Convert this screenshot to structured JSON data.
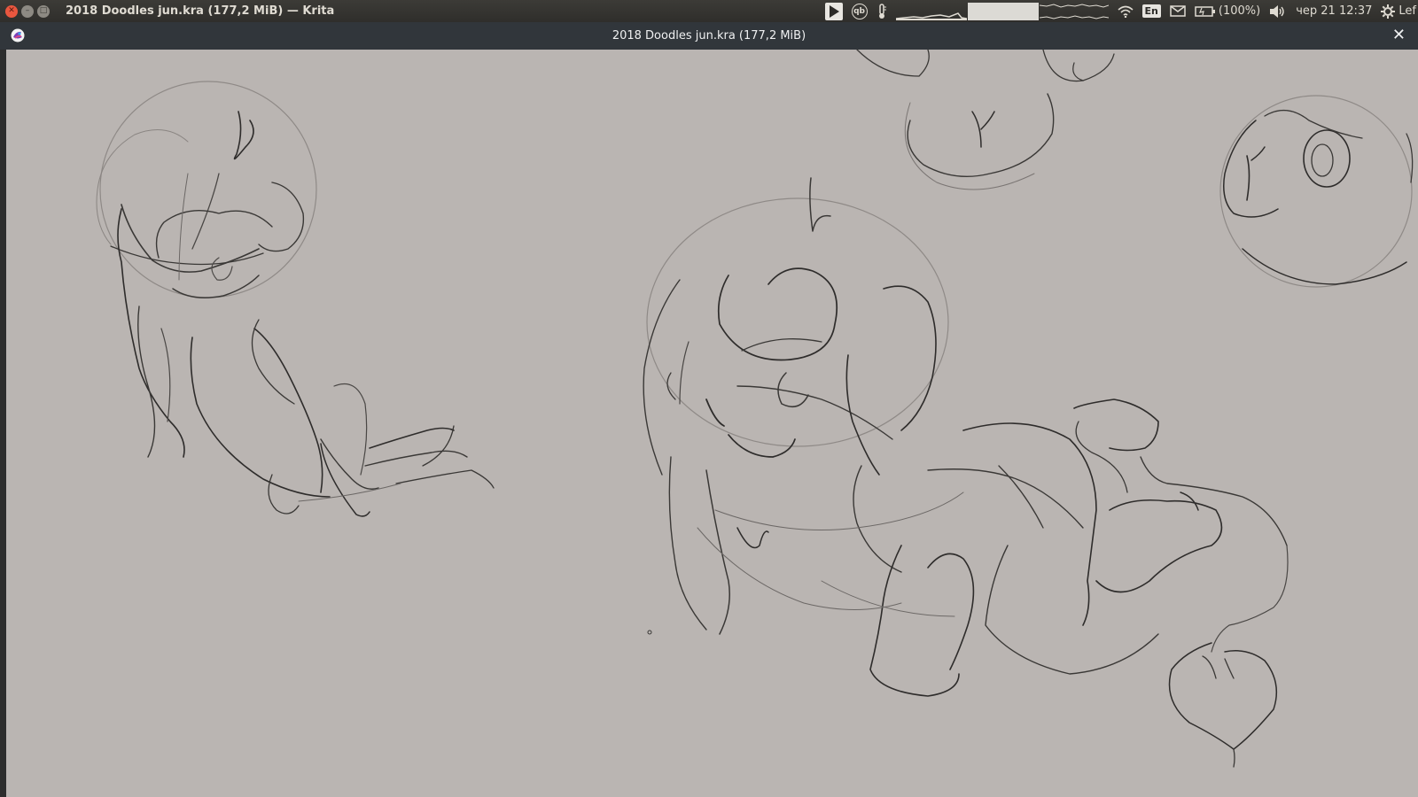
{
  "topbar": {
    "app_title": "2018 Doodles jun.kra (177,2 MiB)  — Krita",
    "language": "En",
    "battery": "(100%)",
    "datetime": "чер 21 12:37",
    "user": "Lef"
  },
  "window": {
    "title": "2018 Doodles jun.kra (177,2 MiB)",
    "close_glyph": "✕"
  },
  "colors": {
    "canvas_bg": "#bab5b2",
    "window_bar": "#31363b",
    "top_panel": "#3c3b37",
    "close_button": "#e9573f"
  },
  "icons": [
    "close-icon",
    "minimize-icon",
    "maximize-icon",
    "play-icon",
    "qbittorrent-icon",
    "temperature-icon",
    "wifi-icon",
    "mail-icon",
    "battery-icon",
    "volume-icon",
    "gear-icon",
    "krita-logo-icon"
  ]
}
